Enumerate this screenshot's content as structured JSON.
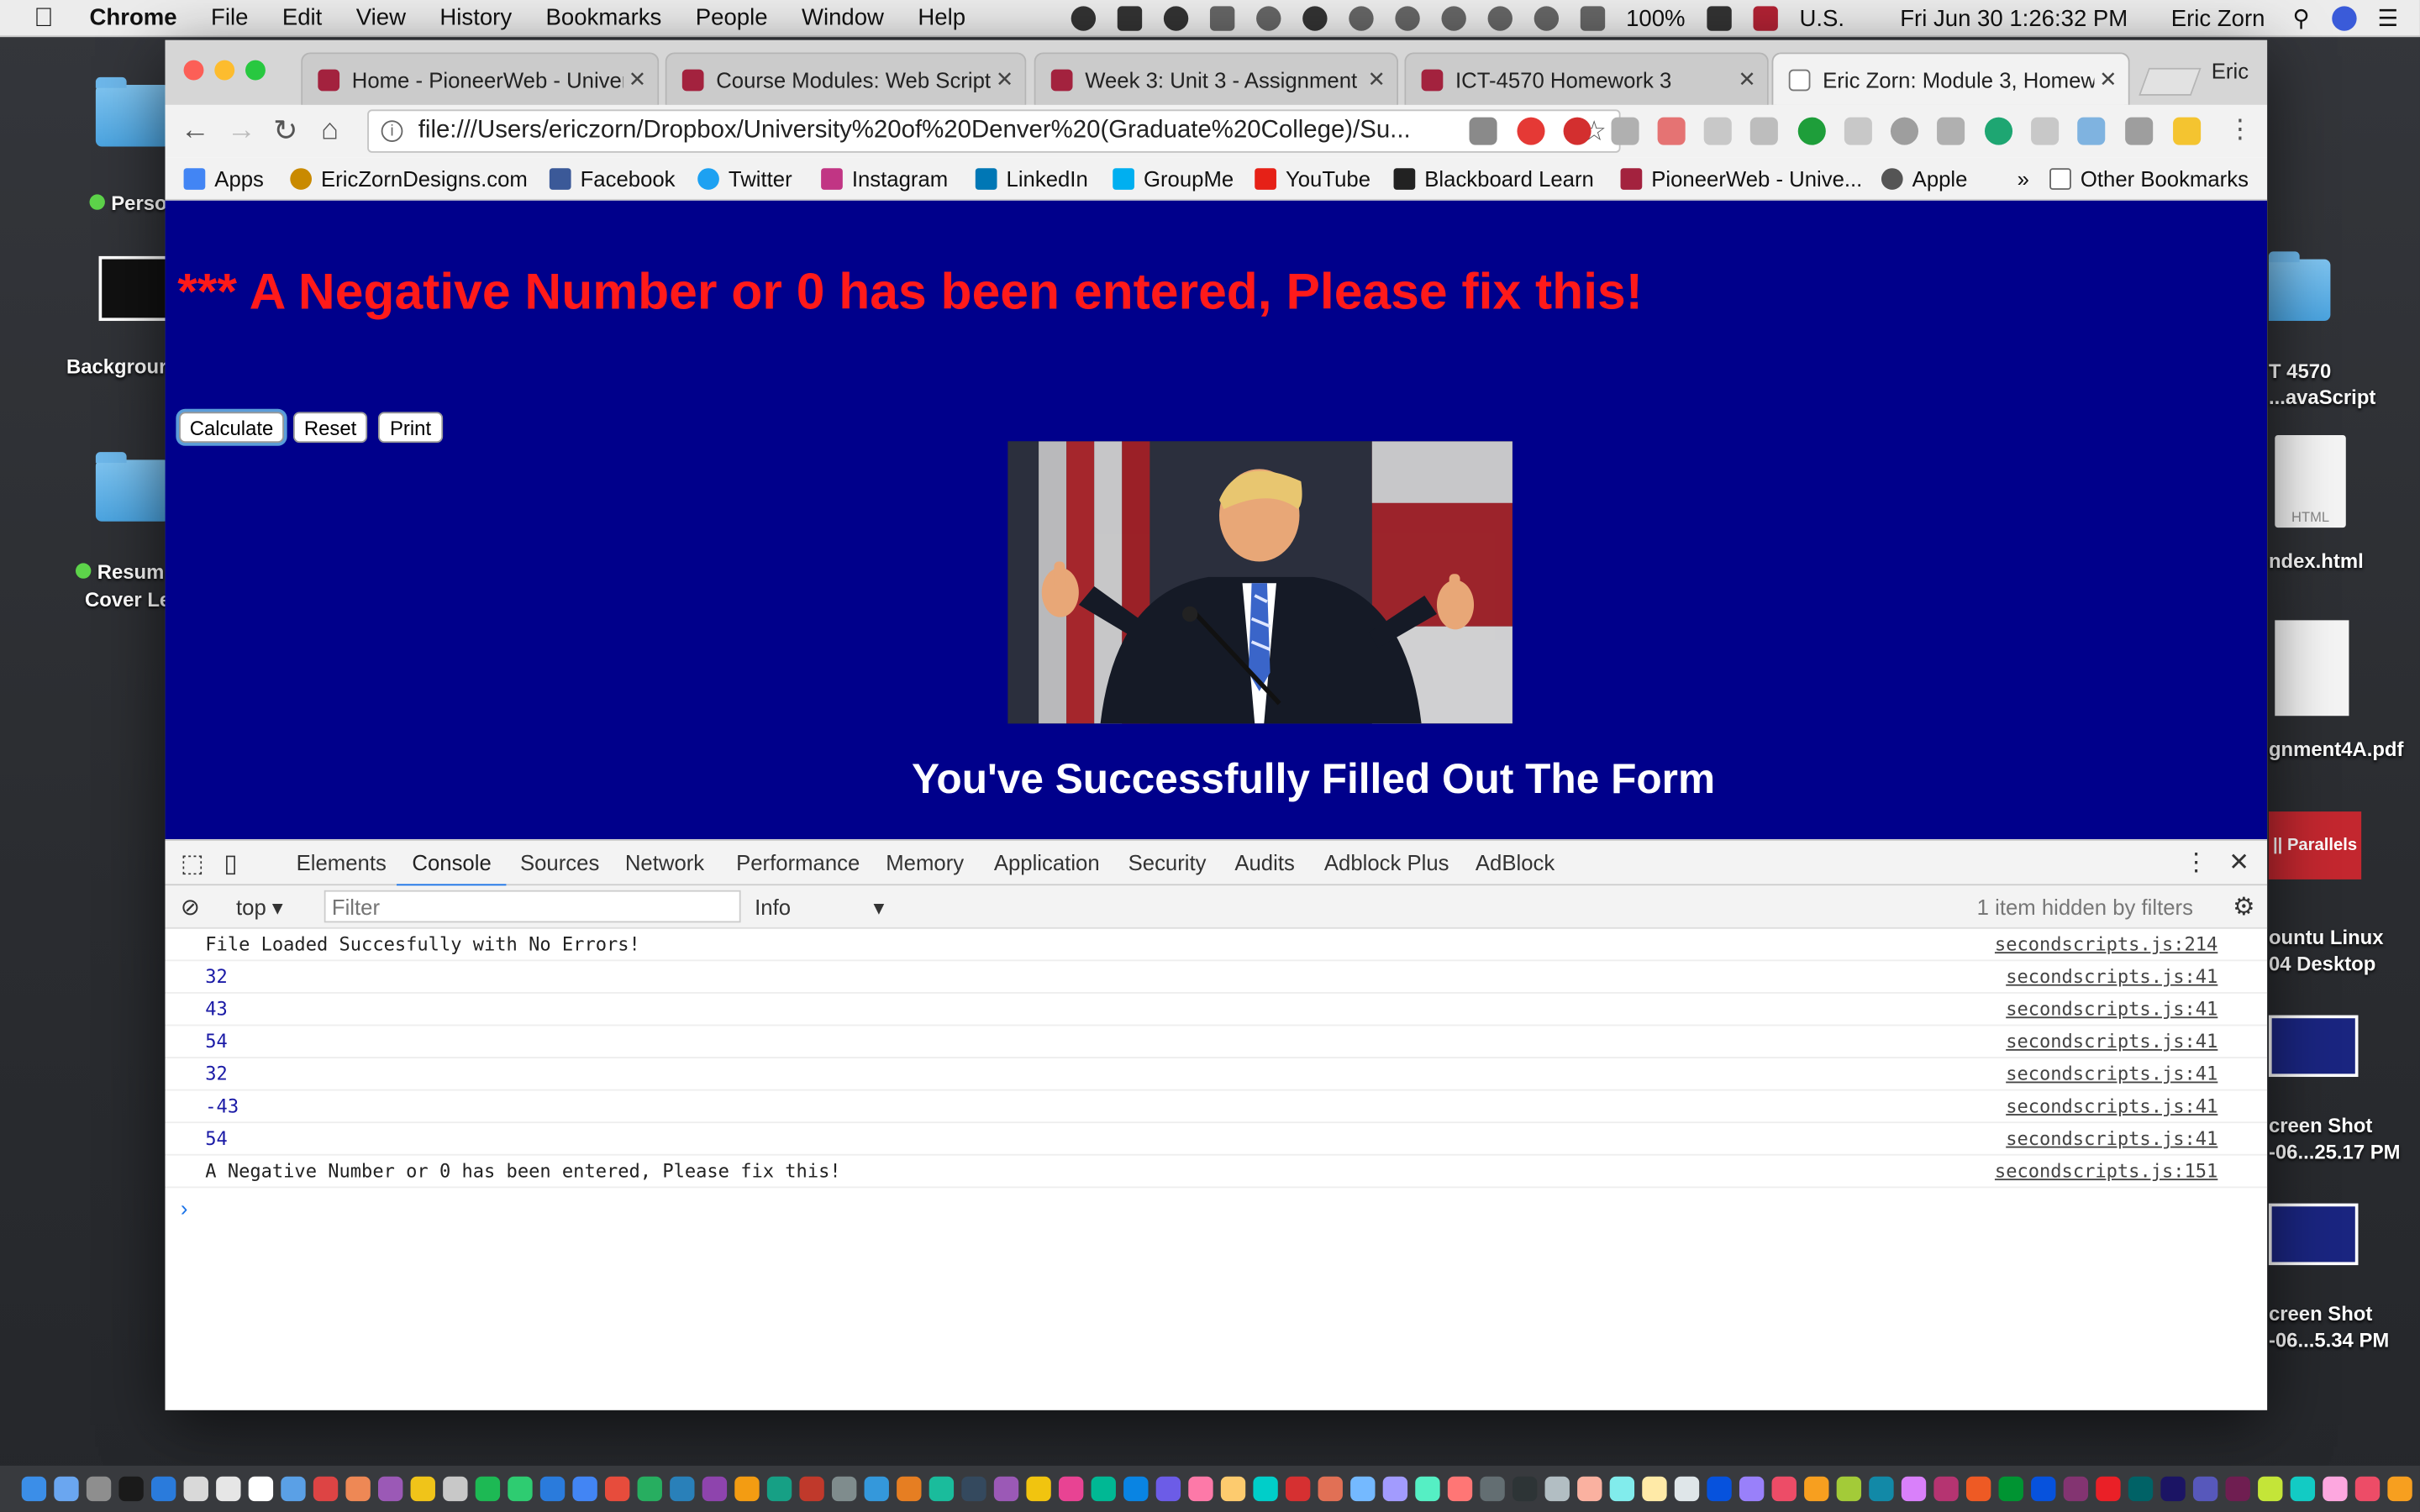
{
  "menubar": {
    "app_name": "Chrome",
    "menus": [
      "File",
      "Edit",
      "View",
      "History",
      "Bookmarks",
      "People",
      "Window",
      "Help"
    ],
    "battery": "100%",
    "input_source": "U.S.",
    "datetime": "Fri Jun 30  1:26:32 PM",
    "user": "Eric Zorn"
  },
  "desktop_left": {
    "item1": "Perso",
    "item2": "Backgrour",
    "item3_line1": "Resum",
    "item3_line2": "Cover Le"
  },
  "desktop_right": {
    "item1_line1": "T 4570",
    "item1_line2": "...avaScript",
    "item2_badge": "HTML",
    "item2": "ndex.html",
    "item3": "gnment4A.pdf",
    "item4_badge": "|| Parallels",
    "item4_line1": "ountu Linux",
    "item4_line2": "04 Desktop",
    "item5_line1": "creen Shot",
    "item5_line2": "-06...25.17 PM",
    "item6_line1": "creen Shot",
    "item6_line2": "-06...5.34 PM"
  },
  "browser": {
    "tabs": [
      {
        "label": "Home - PioneerWeb - Univer"
      },
      {
        "label": "Course Modules: Web Scripti"
      },
      {
        "label": "Week 3: Unit 3 - Assignment"
      },
      {
        "label": "ICT-4570 Homework 3"
      },
      {
        "label": "Eric Zorn: Module 3, Homewo"
      }
    ],
    "profile": "Eric",
    "url": "file:///Users/ericzorn/Dropbox/University%20of%20Denver%20(Graduate%20College)/Su...",
    "bookmarks": [
      "Apps",
      "EricZornDesigns.com",
      "Facebook",
      "Twitter",
      "Instagram",
      "LinkedIn",
      "GroupMe",
      "YouTube",
      "Blackboard Learn",
      "PioneerWeb - Unive...",
      "Apple"
    ],
    "bookmarks_overflow": "»",
    "other_bookmarks": "Other Bookmarks"
  },
  "page": {
    "error_heading": "*** A Negative Number or 0 has been entered, Please fix this!",
    "buttons": {
      "calculate": "Calculate",
      "reset": "Reset",
      "print": "Print"
    },
    "success_message": "You've Successfully Filled Out The Form",
    "background_color": "#00008b",
    "error_color": "#ff1a1a"
  },
  "devtools": {
    "tabs": [
      "Elements",
      "Console",
      "Sources",
      "Network",
      "Performance",
      "Memory",
      "Application",
      "Security",
      "Audits",
      "Adblock Plus",
      "AdBlock"
    ],
    "active_tab": "Console",
    "context": "top",
    "filter_placeholder": "Filter",
    "level": "Info",
    "hidden_note": "1 item hidden by filters",
    "console_rows": [
      {
        "msg": "File Loaded Succesfully with No Errors!",
        "src": "secondscripts.js:214",
        "numeric": false
      },
      {
        "msg": "32",
        "src": "secondscripts.js:41",
        "numeric": true
      },
      {
        "msg": "43",
        "src": "secondscripts.js:41",
        "numeric": true
      },
      {
        "msg": "54",
        "src": "secondscripts.js:41",
        "numeric": true
      },
      {
        "msg": "32",
        "src": "secondscripts.js:41",
        "numeric": true
      },
      {
        "msg": "-43",
        "src": "secondscripts.js:41",
        "numeric": true
      },
      {
        "msg": "54",
        "src": "secondscripts.js:41",
        "numeric": true
      },
      {
        "msg": "A Negative Number or 0 has been entered, Please fix this!",
        "src": "secondscripts.js:151",
        "numeric": false
      }
    ],
    "prompt": "›"
  }
}
